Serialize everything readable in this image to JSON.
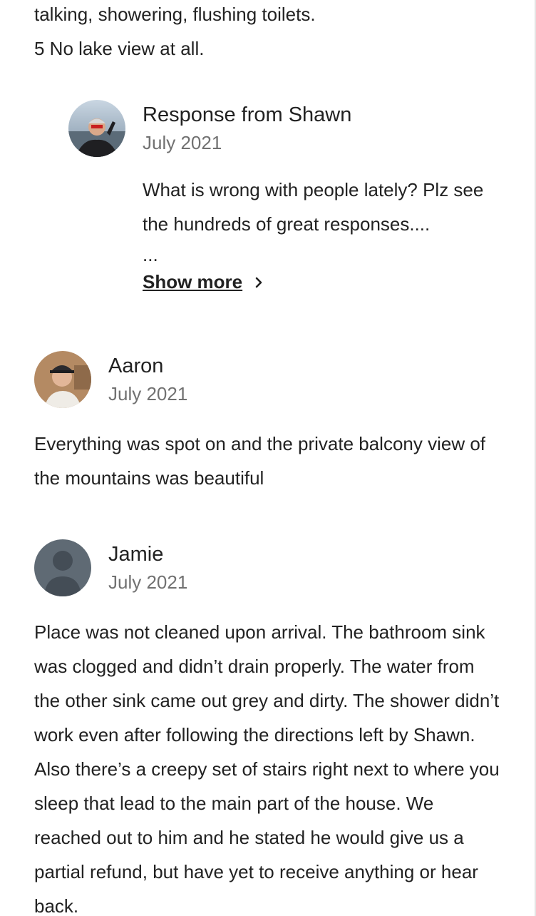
{
  "top_review": {
    "lines": [
      "talking, showering, flushing toilets.",
      "5 No lake view at all."
    ]
  },
  "host_response": {
    "title": "Response from Shawn",
    "date": "July 2021",
    "text": "What is wrong with people lately? Plz see the hundreds of great responses....",
    "ellipsis": "...",
    "show_more_label": "Show more"
  },
  "reviews": [
    {
      "name": "Aaron",
      "date": "July 2021",
      "text": "Everything was spot on and the private balcony view of the mountains was beautiful"
    },
    {
      "name": "Jamie",
      "date": "July 2021",
      "text": "Place was not cleaned upon arrival. The bathroom sink was clogged and didn’t drain properly. The water from the other sink came out grey and dirty. The shower didn’t work even after following the directions left by Shawn. Also there’s a creepy set of stairs right next to where you sleep that lead to the main part of the house. We reached out to him and he stated he would give us a partial refund, but have yet to receive anything or hear back."
    }
  ],
  "icons": {
    "chevron": "chevron-right-icon",
    "default_avatar": "default-user-avatar-icon"
  }
}
